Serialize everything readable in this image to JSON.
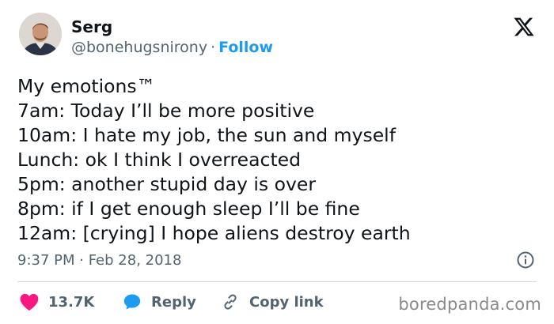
{
  "author": {
    "name": "Serg",
    "handle": "@bonehugsnirony",
    "separator": "·",
    "follow_label": "Follow"
  },
  "tweet": {
    "lines": [
      "My emotions™",
      "7am: Today I’ll be more positive",
      "10am: I hate my job, the sun and myself",
      "Lunch: ok I think I overreacted",
      "5pm: another stupid day is over",
      "8pm: if I get enough sleep I’ll be fine",
      "12am: [crying] I hope aliens destroy earth"
    ],
    "timestamp": "9:37 PM · Feb 28, 2018"
  },
  "actions": {
    "like_count": "13.7K",
    "reply_label": "Reply",
    "copy_link_label": "Copy link"
  },
  "watermark": "boredpanda.com",
  "icons": {
    "brand": "x-logo-icon",
    "info": "info-icon",
    "like": "heart-icon",
    "reply": "speech-bubble-icon",
    "copy_link": "link-icon"
  },
  "colors": {
    "follow": "#1d9bf0",
    "like": "#f91880",
    "reply": "#1d9bf0",
    "secondary_text": "#536471",
    "primary_text": "#0f1419"
  }
}
